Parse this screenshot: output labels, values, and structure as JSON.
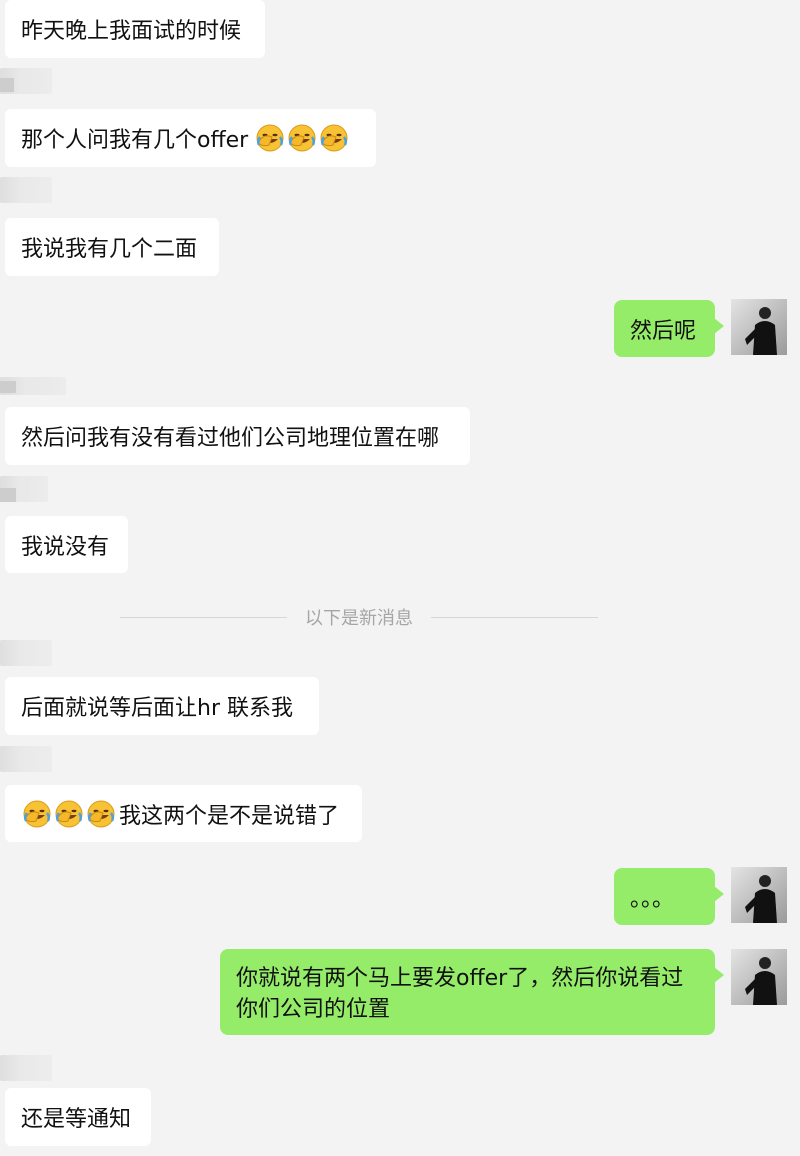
{
  "chat": {
    "messages": [
      {
        "side": "in",
        "text": "昨天晚上我面试的时候"
      },
      {
        "side": "in",
        "text": "那个人问我有几个offer",
        "trailing_emoji": [
          "facepalm-laugh",
          "facepalm-laugh",
          "facepalm-laugh"
        ]
      },
      {
        "side": "in",
        "text": "我说我有几个二面"
      },
      {
        "side": "out",
        "text": "然后呢"
      },
      {
        "side": "in",
        "text": "然后问我有没有看过他们公司地理位置在哪"
      },
      {
        "side": "in",
        "text": "我说没有"
      },
      {
        "side": "in",
        "text": "后面就说等后面让hr 联系我"
      },
      {
        "side": "in",
        "text": "我这两个是不是说错了",
        "leading_emoji": [
          "facepalm-laugh",
          "facepalm-laugh",
          "facepalm-laugh"
        ]
      },
      {
        "side": "out",
        "text": "。。。"
      },
      {
        "side": "out",
        "text": "你就说有两个马上要发offer了，然后你说看过你们公司的位置"
      },
      {
        "side": "in",
        "text": "还是等通知"
      }
    ],
    "new_messages_divider": "以下是新消息"
  },
  "colors": {
    "background": "#f3f3f3",
    "incoming_bubble": "#ffffff",
    "outgoing_bubble": "#95ec69",
    "divider_text": "#a6a6a6"
  }
}
